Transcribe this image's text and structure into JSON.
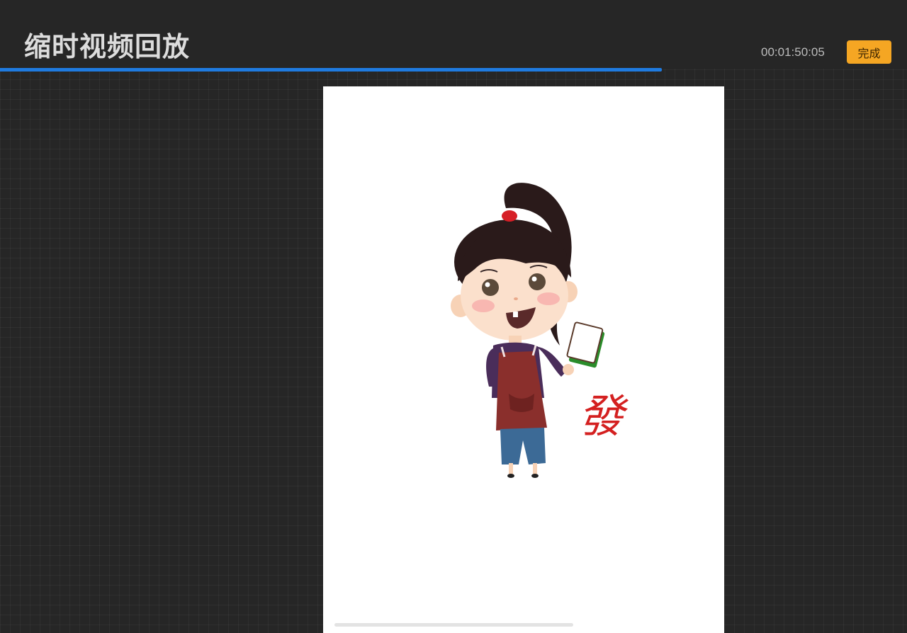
{
  "header": {
    "title": "缩时视频回放",
    "timecode": "00:01:50:05",
    "done_label": "完成"
  },
  "playback": {
    "progress": 0.73
  },
  "colors": {
    "accent_blue": "#1f7be0",
    "done_button": "#f5a623",
    "background": "#262626",
    "canvas": "#ffffff"
  },
  "artwork": {
    "character_glyph": "發"
  }
}
